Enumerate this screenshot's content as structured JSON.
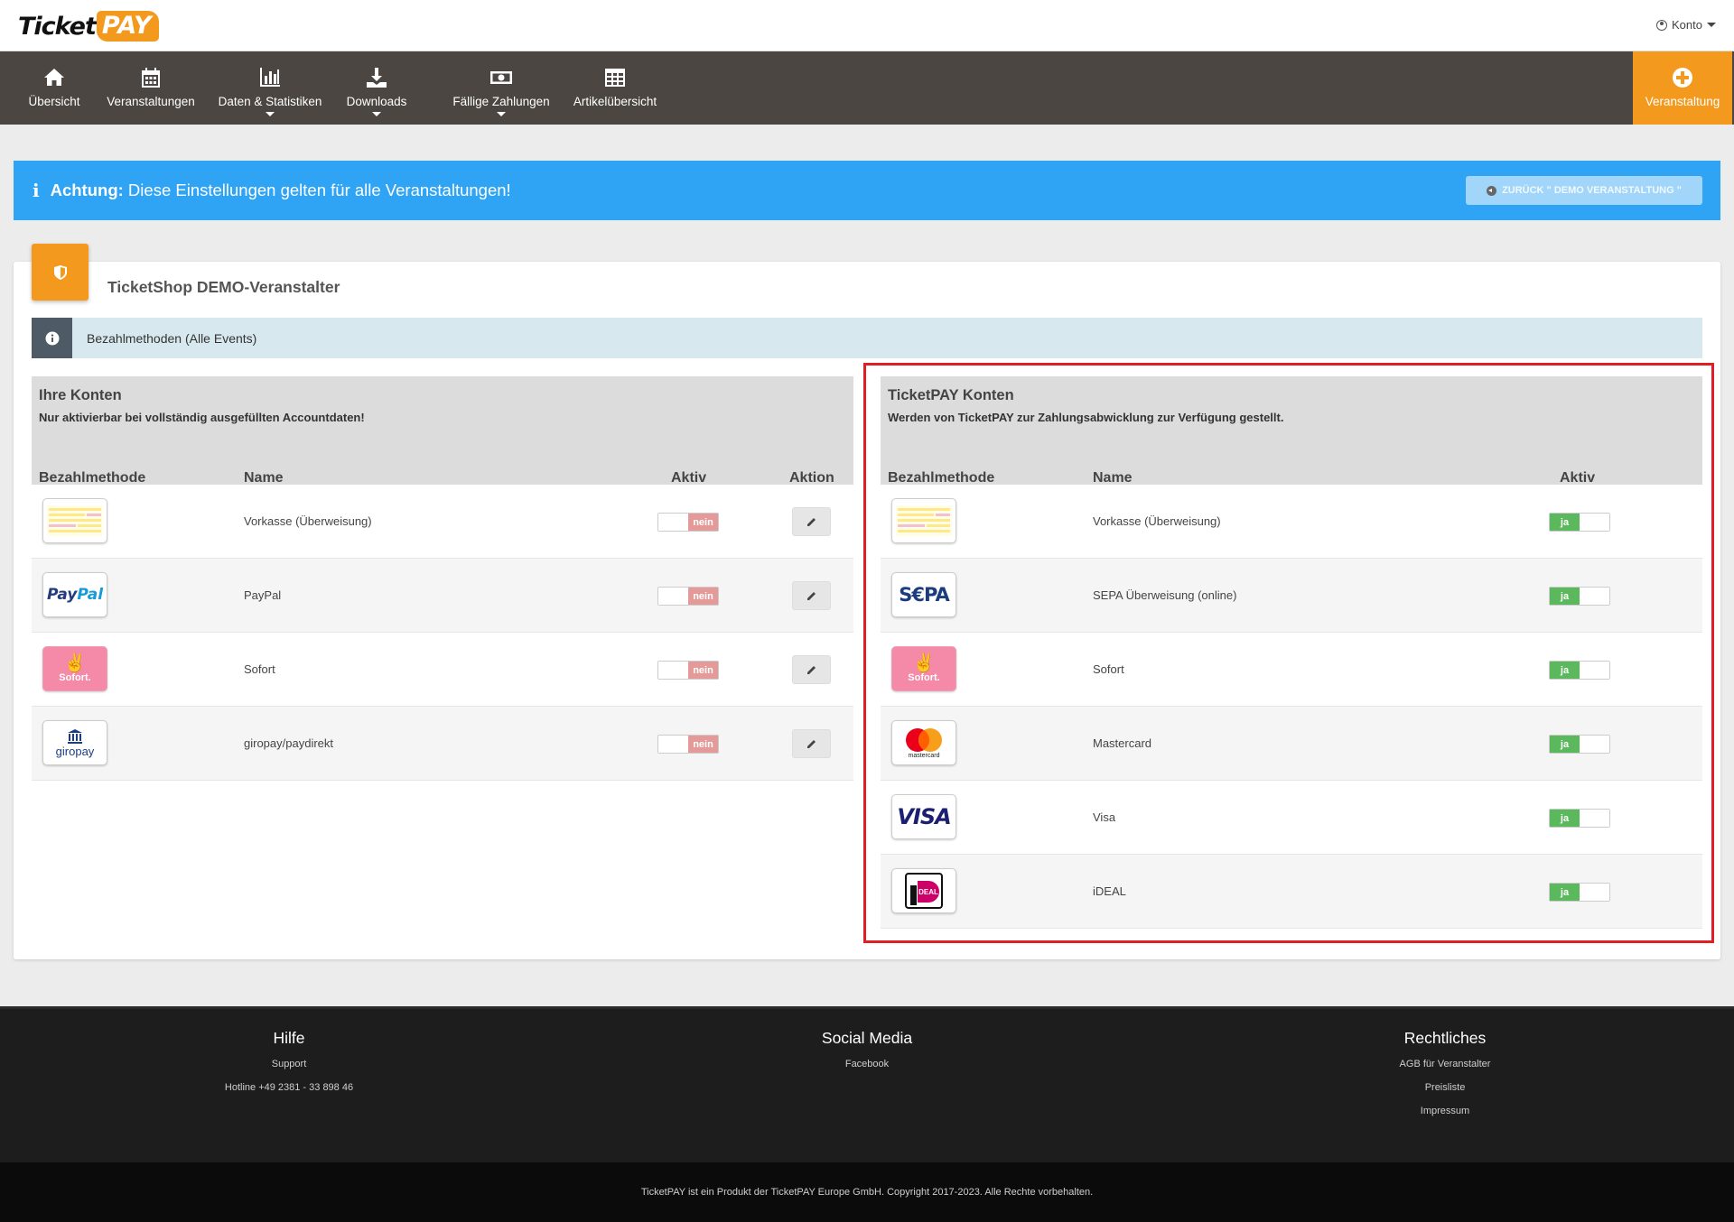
{
  "brand": {
    "ticket": "Ticket",
    "pay": "PAY",
    "accent": "#f39a1e"
  },
  "account": {
    "label": "Konto"
  },
  "nav": {
    "items": [
      {
        "label": "Übersicht",
        "icon": "home-icon"
      },
      {
        "label": "Veranstaltungen",
        "icon": "calendar-icon"
      },
      {
        "label": "Daten & Statistiken",
        "icon": "bar-chart-icon",
        "has_submenu": true
      },
      {
        "label": "Downloads",
        "icon": "download-icon",
        "has_submenu": true
      },
      {
        "label": "Fällige Zahlungen",
        "icon": "money-icon",
        "has_submenu": true
      },
      {
        "label": "Artikelübersicht",
        "icon": "table-icon"
      }
    ],
    "new_event": {
      "label": "Veranstaltung",
      "icon": "plus-circle-icon"
    }
  },
  "alert": {
    "strong": "Achtung:",
    "text": " Diese Einstellungen gelten für alle Veranstaltungen!",
    "back_button": "ZURÜCK \" DEMO VERANSTALTUNG \"",
    "color": "#2fa4f4"
  },
  "card": {
    "title": "TicketShop DEMO-Veranstalter",
    "subheader": "Bezahlmethoden (Alle Events)"
  },
  "own_accounts": {
    "title": "Ihre Konten",
    "subtitle": "Nur aktivierbar bei vollständig ausgefüllten Accountdaten!",
    "columns": {
      "method": "Bezahlmethode",
      "name": "Name",
      "active": "Aktiv",
      "action": "Aktion"
    },
    "rows": [
      {
        "logo": "invoice-form-logo",
        "name": "Vorkasse (Überweisung)",
        "active": "nein"
      },
      {
        "logo": "paypal-logo",
        "name": "PayPal",
        "active": "nein"
      },
      {
        "logo": "sofort-logo",
        "name": "Sofort",
        "active": "nein"
      },
      {
        "logo": "giropay-logo",
        "name": "giropay/paydirekt",
        "active": "nein"
      }
    ]
  },
  "ticketpay_accounts": {
    "title": "TicketPAY Konten",
    "subtitle": "Werden von TicketPAY zur Zahlungsabwicklung zur Verfügung gestellt.",
    "columns": {
      "method": "Bezahlmethode",
      "name": "Name",
      "active": "Aktiv"
    },
    "rows": [
      {
        "logo": "invoice-form-logo",
        "name": "Vorkasse (Überweisung)",
        "active": "ja"
      },
      {
        "logo": "sepa-logo",
        "name": "SEPA Überweisung (online)",
        "active": "ja"
      },
      {
        "logo": "sofort-logo",
        "name": "Sofort",
        "active": "ja"
      },
      {
        "logo": "mastercard-logo",
        "name": "Mastercard",
        "active": "ja"
      },
      {
        "logo": "visa-logo",
        "name": "Visa",
        "active": "ja"
      },
      {
        "logo": "ideal-logo",
        "name": "iDEAL",
        "active": "ja"
      }
    ]
  },
  "logo_text": {
    "paypal_a": "Pay",
    "paypal_b": "Pal",
    "sofort": "Sofort.",
    "giropay": "giropay",
    "sepa": "S€PA",
    "mastercard": "mastercard",
    "visa": "VISA",
    "ideal": "DEAL"
  },
  "footer": {
    "help": {
      "title": "Hilfe",
      "links": [
        "Support",
        "Hotline +49 2381 - 33 898 46"
      ]
    },
    "social": {
      "title": "Social Media",
      "links": [
        "Facebook"
      ]
    },
    "legal": {
      "title": "Rechtliches",
      "links": [
        "AGB für Veranstalter",
        "Preisliste",
        "Impressum"
      ]
    },
    "copyright": "TicketPAY ist ein Produkt der TicketPAY Europe GmbH. Copyright 2017-2023. Alle Rechte vorbehalten."
  },
  "colors": {
    "toggle_on": "#5cb85c",
    "toggle_off": "#e49a98",
    "nav_bg": "#4b4641",
    "highlight_frame": "#e01e26"
  }
}
